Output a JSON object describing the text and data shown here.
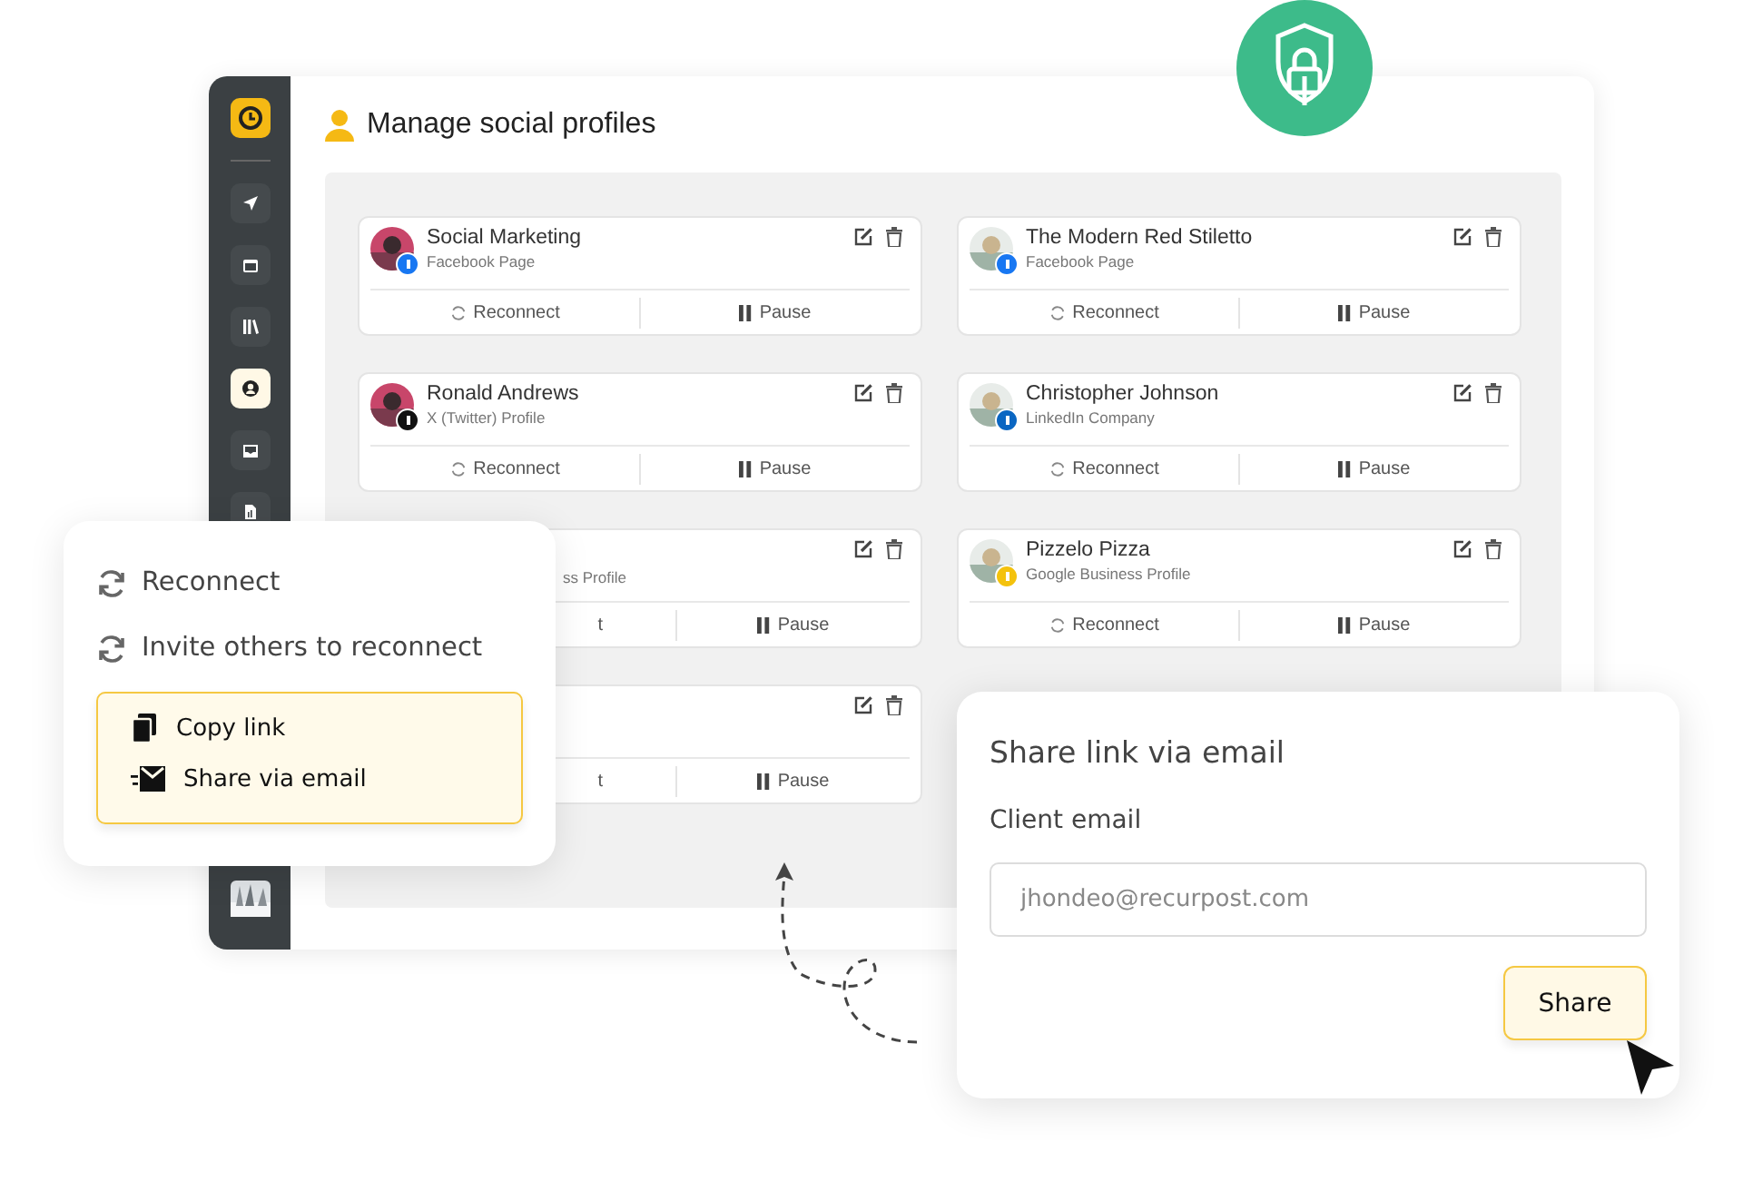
{
  "sidebar": {
    "items": [
      {
        "kind": "send",
        "selected": false
      },
      {
        "kind": "calendar",
        "selected": false
      },
      {
        "kind": "library",
        "selected": false
      },
      {
        "kind": "profile",
        "selected": true
      },
      {
        "kind": "inbox",
        "selected": false
      },
      {
        "kind": "report",
        "selected": false
      }
    ]
  },
  "header": {
    "title": "Manage social profiles"
  },
  "profiles": [
    {
      "kind": "facebook",
      "name": "Social Marketing",
      "subtitle": "Facebook Page",
      "reconnect": "Reconnect",
      "pause": "Pause"
    },
    {
      "kind": "facebook",
      "name": "The Modern Red Stiletto",
      "subtitle": "Facebook Page",
      "reconnect": "Reconnect",
      "pause": "Pause"
    },
    {
      "kind": "x",
      "name": "Ronald Andrews",
      "subtitle": "X (Twitter) Profile",
      "reconnect": "Reconnect",
      "pause": "Pause"
    },
    {
      "kind": "linkedin",
      "name": "Christopher Johnson",
      "subtitle": "LinkedIn Company",
      "reconnect": "Reconnect",
      "pause": "Pause"
    },
    {
      "kind": "covered",
      "subtitle": "ss Profile",
      "reconnect": "t",
      "pause": "Pause"
    },
    {
      "kind": "google",
      "name": "Pizzelo Pizza",
      "subtitle": "Google Business Profile",
      "reconnect": "Reconnect",
      "pause": "Pause"
    },
    {
      "kind": "covered",
      "reconnect": "t",
      "pause": "Pause"
    }
  ],
  "menu": {
    "items": [
      {
        "label": "Reconnect"
      },
      {
        "label": "Invite others to reconnect"
      }
    ],
    "sub_items": [
      {
        "kind": "copy",
        "label": "Copy link"
      },
      {
        "kind": "email",
        "label": "Share via email"
      }
    ]
  },
  "share_dialog": {
    "title": "Share link via email",
    "label": "Client email",
    "placeholder": "jhondeo@recurpost.com",
    "button": "Share"
  }
}
